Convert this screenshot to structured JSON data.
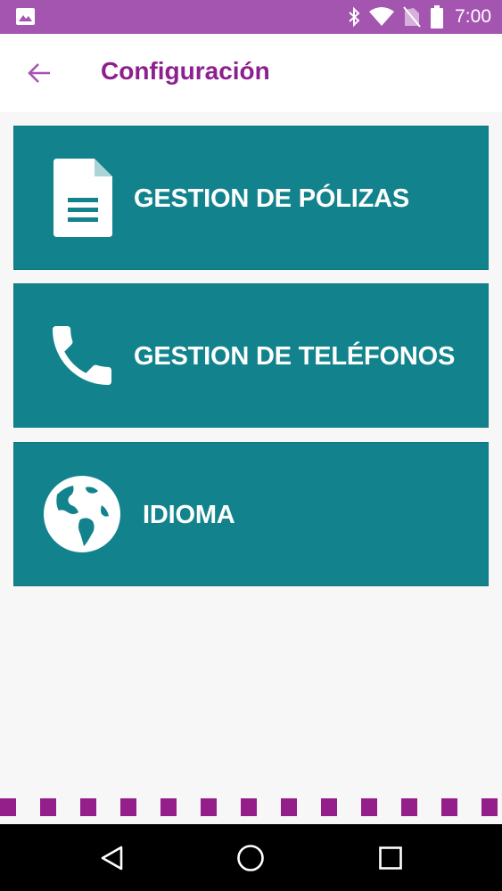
{
  "status_bar": {
    "time": "7:00",
    "icons": [
      "image-icon",
      "bluetooth-icon",
      "wifi-icon",
      "no-sim-icon",
      "battery-icon"
    ]
  },
  "app_bar": {
    "title": "Configuración",
    "back_icon": "arrow-left-icon",
    "accent_color": "#8e1f8e"
  },
  "menu": {
    "card_color": "#12838d",
    "items": [
      {
        "label": "GESTION DE PÓLIZAS",
        "icon": "document-icon"
      },
      {
        "label": "GESTION DE TELÉFONOS",
        "icon": "phone-icon"
      },
      {
        "label": "IDIOMA",
        "icon": "globe-icon"
      }
    ]
  },
  "nav_bar": {
    "icons": [
      "back-triangle-icon",
      "home-circle-icon",
      "recents-square-icon"
    ]
  },
  "colors": {
    "status_bar": "#a455b0",
    "decorative_dots": "#951f8a",
    "background": "#f7f7f8"
  }
}
